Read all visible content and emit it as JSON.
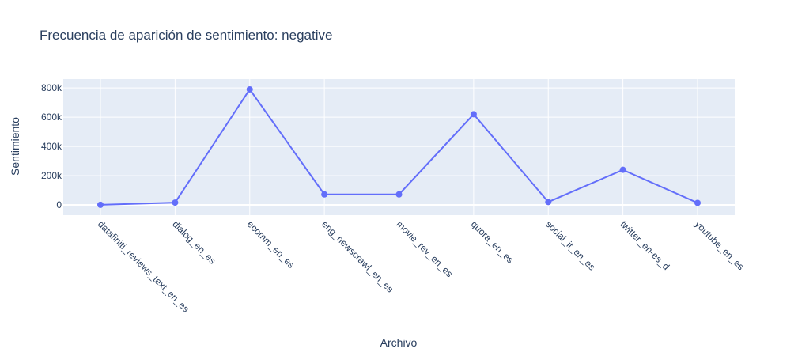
{
  "chart_data": {
    "type": "line",
    "title": "Frecuencia de aparición de sentimiento: negative",
    "xlabel": "Archivo",
    "ylabel": "Sentimiento",
    "categories": [
      "datafiniti_reviews_text_en_es",
      "dialog_en_es",
      "ecomm_en_es",
      "eng_newscrawl_en_es",
      "movie_rev_en_es",
      "quora_en_es",
      "social_it_en_es",
      "twitter_en-es_d",
      "youtube_en_es"
    ],
    "values": [
      1000,
      16000,
      790000,
      72000,
      72000,
      620000,
      20000,
      240000,
      14000
    ],
    "ylim": [
      -70000,
      860000
    ],
    "yticks": [
      0,
      200000,
      400000,
      600000,
      800000
    ],
    "ytick_labels": [
      "0",
      "200k",
      "400k",
      "600k",
      "800k"
    ],
    "grid": true,
    "colors": {
      "line": "#636efa",
      "plot_bg": "#e5ecf6",
      "grid": "#ffffff"
    }
  }
}
